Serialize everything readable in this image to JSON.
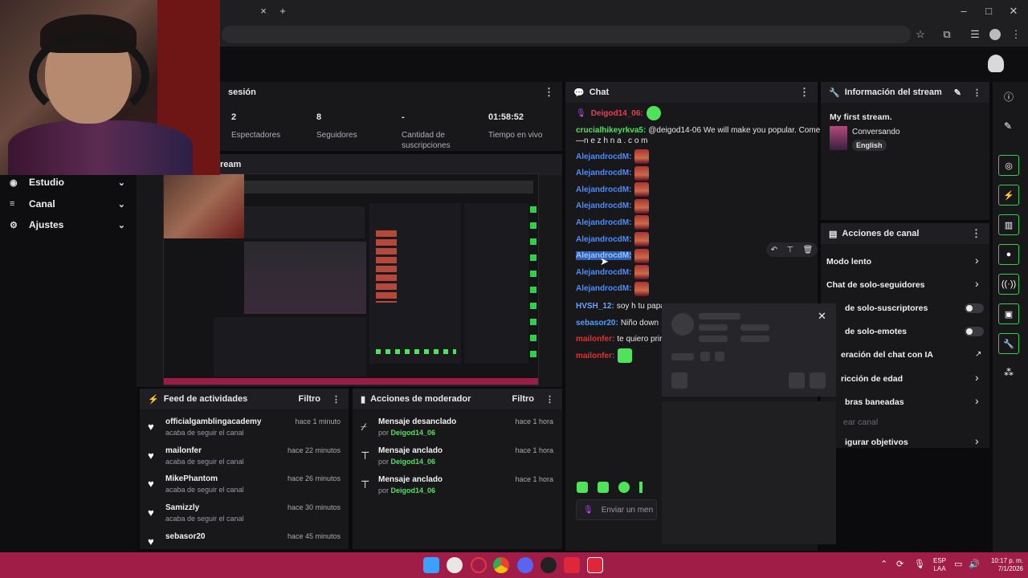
{
  "browser": {
    "new_tab": "+",
    "close_tab": "×",
    "win_min": "–",
    "win_max": "□",
    "win_close": "✕"
  },
  "nav": {
    "items": [
      {
        "label": "Estudio",
        "icon": "studio-icon"
      },
      {
        "label": "Canal",
        "icon": "channel-icon"
      },
      {
        "label": "Ajustes",
        "icon": "gear-icon"
      }
    ]
  },
  "session": {
    "title": "sesión",
    "stats": [
      {
        "value": "2",
        "label": "Espectadores"
      },
      {
        "value": "8",
        "label": "Seguidores"
      },
      {
        "value": "-",
        "label": "Cantidad de suscripciones"
      },
      {
        "value": "01:58:52",
        "label": "Tiempo en vivo"
      }
    ]
  },
  "stream_panel": {
    "title": "ream"
  },
  "activity": {
    "title": "Feed de actividades",
    "filter": "Filtro",
    "items": [
      {
        "name": "officialgamblingacademy",
        "sub": "acaba de seguir el canal",
        "time": "hace 1 minuto"
      },
      {
        "name": "mailonfer",
        "sub": "acaba de seguir el canal",
        "time": "hace 22 minutos"
      },
      {
        "name": "MikePhantom",
        "sub": "acaba de seguir el canal",
        "time": "hace 26 minutos"
      },
      {
        "name": "Samizzly",
        "sub": "acaba de seguir el canal",
        "time": "hace 30 minutos"
      },
      {
        "name": "sebasor20",
        "sub": "",
        "time": "hace 45 minutos"
      }
    ]
  },
  "mod_actions": {
    "title": "Acciones de moderador",
    "filter": "Filtro",
    "items": [
      {
        "action": "Mensaje desanclado",
        "by_prefix": "por",
        "by": "Deigod14_06",
        "time": "hace 1 hora",
        "icon": "unpin-icon"
      },
      {
        "action": "Mensaje anclado",
        "by_prefix": "por",
        "by": "Deigod14_06",
        "time": "hace 1 hora",
        "icon": "pin-icon"
      },
      {
        "action": "Mensaje anclado",
        "by_prefix": "por",
        "by": "Deigod14_06",
        "time": "hace 1 hora",
        "icon": "pin-icon"
      }
    ]
  },
  "chat": {
    "title": "Chat",
    "pinned_user": "Deigod14_06:",
    "message_1_user": "crucialhikeyrkva5:",
    "message_1_text": "@deigod14-06 We will make you popular. Come in",
    "message_1_cont": "—n e z h n a . c o m",
    "repeat_user": "AlejandrocdM:",
    "repeat_count": 9,
    "m_hvsh_user": "HVSH_12:",
    "m_hvsh_text": "soy h tu papa",
    "m_seb_user": "sebasor20:",
    "m_seb_text": "Niño down",
    "m_mail_user": "mailonfer:",
    "m_mail_text": "te quiero prir",
    "m_mail2_user": "mailonfer:",
    "input_placeholder": "Enviar un men"
  },
  "stream_info": {
    "title": "Información del stream",
    "stream_title": "My first stream.",
    "category": "Conversando",
    "language": "English"
  },
  "channel_actions": {
    "title": "Acciones de canal",
    "items": [
      {
        "label": "Modo lento"
      },
      {
        "label": "Chat de solo-seguidores"
      },
      {
        "label": "de solo-suscriptores"
      },
      {
        "label": "de solo-emotes"
      },
      {
        "label": "eración del chat con IA"
      },
      {
        "label": "ricción de edad"
      },
      {
        "label": "bras baneadas"
      },
      {
        "label": "ear canal"
      },
      {
        "label": "igurar objetivos"
      }
    ]
  },
  "taskbar": {
    "lang": "ESP",
    "lang2": "LAA",
    "time": "10:17 p. m.",
    "date": "7/1/2026"
  },
  "colors": {
    "accent": "#4ee35a",
    "taskbar": "#a01d48",
    "username": "#4a8cff",
    "danger": "#e0302f"
  }
}
